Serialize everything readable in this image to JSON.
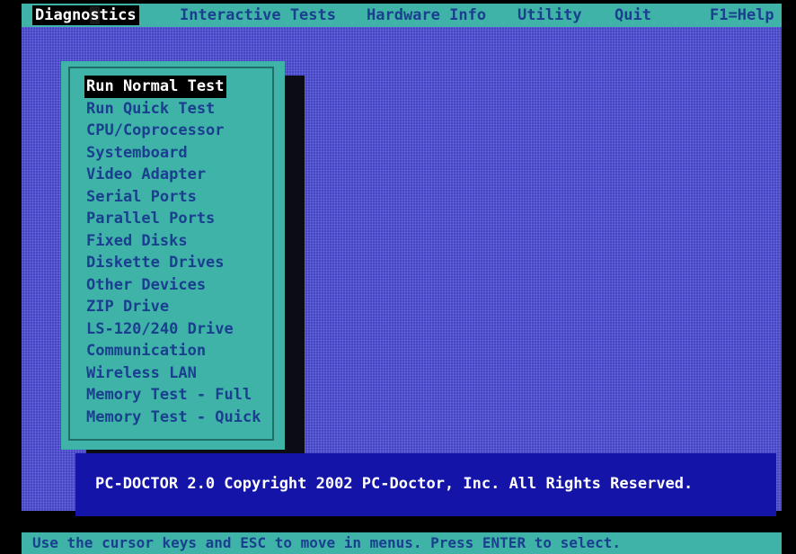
{
  "menubar": {
    "items": [
      {
        "label_a": "Diagno",
        "label_b": "s",
        "label_c": "tics"
      },
      {
        "label": "Interactive Tests"
      },
      {
        "label": "Hardware Info"
      },
      {
        "label": "Utility"
      },
      {
        "label": "Quit"
      },
      {
        "label": "F1=Help"
      }
    ]
  },
  "dropdown": {
    "items": [
      "Run Normal Test",
      "Run Quick Test",
      "CPU/Coprocessor",
      "Systemboard",
      "Video Adapter",
      "Serial Ports",
      "Parallel Ports",
      "Fixed Disks",
      "Diskette Drives",
      "Other Devices",
      "ZIP Drive",
      "LS-120/240 Drive",
      "Communication",
      "Wireless LAN",
      "Memory Test - Full",
      "Memory Test - Quick"
    ],
    "selected_index": 0
  },
  "banner": {
    "text": "PC-DOCTOR 2.0  Copyright 2002 PC-Doctor, Inc. All Rights Reserved."
  },
  "statusbar": {
    "text": "Use the cursor keys and ESC to move in menus. Press ENTER to select."
  },
  "colors": {
    "desktop": "#4545c4",
    "menu": "#3fb3a8",
    "menu_text": "#1a3f8f",
    "banner": "#1414a8"
  }
}
